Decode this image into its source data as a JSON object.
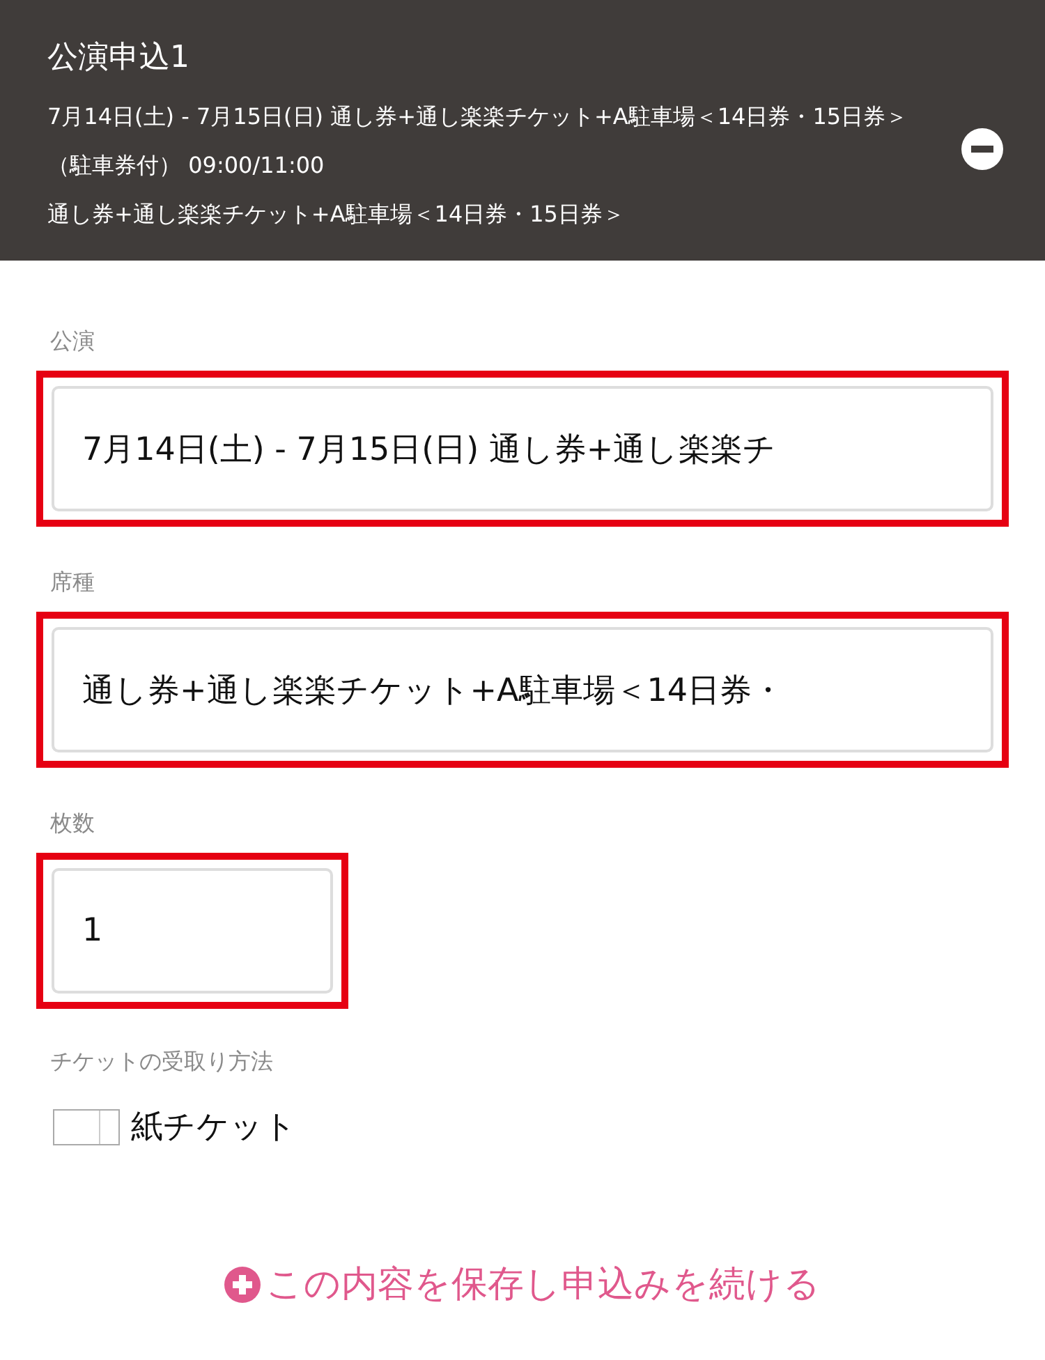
{
  "header": {
    "title": "公演申込1",
    "lines": [
      "7月14日(土) - 7月15日(日) 通し券+通し楽楽チケット+A駐車場＜14日券・15日券＞（駐車券付） 09:00/11:00",
      "通し券+通し楽楽チケット+A駐車場＜14日券・15日券＞"
    ]
  },
  "fields": [
    {
      "label": "公演",
      "value": "7月14日(土)  -  7月15日(日) 通し券+通し楽楽チ",
      "highlighted": true,
      "kind": "text"
    },
    {
      "label": "席種",
      "value": "通し券+通し楽楽チケット+A駐車場＜14日券・",
      "highlighted": true,
      "kind": "text"
    },
    {
      "label": "枚数",
      "value": "1",
      "highlighted": true,
      "kind": "number"
    }
  ],
  "delivery": {
    "label": "チケットの受取り方法",
    "options": [
      {
        "label": "紙チケット",
        "checked": false
      }
    ]
  },
  "submit": {
    "label": "この内容を保存し申込みを続ける"
  }
}
